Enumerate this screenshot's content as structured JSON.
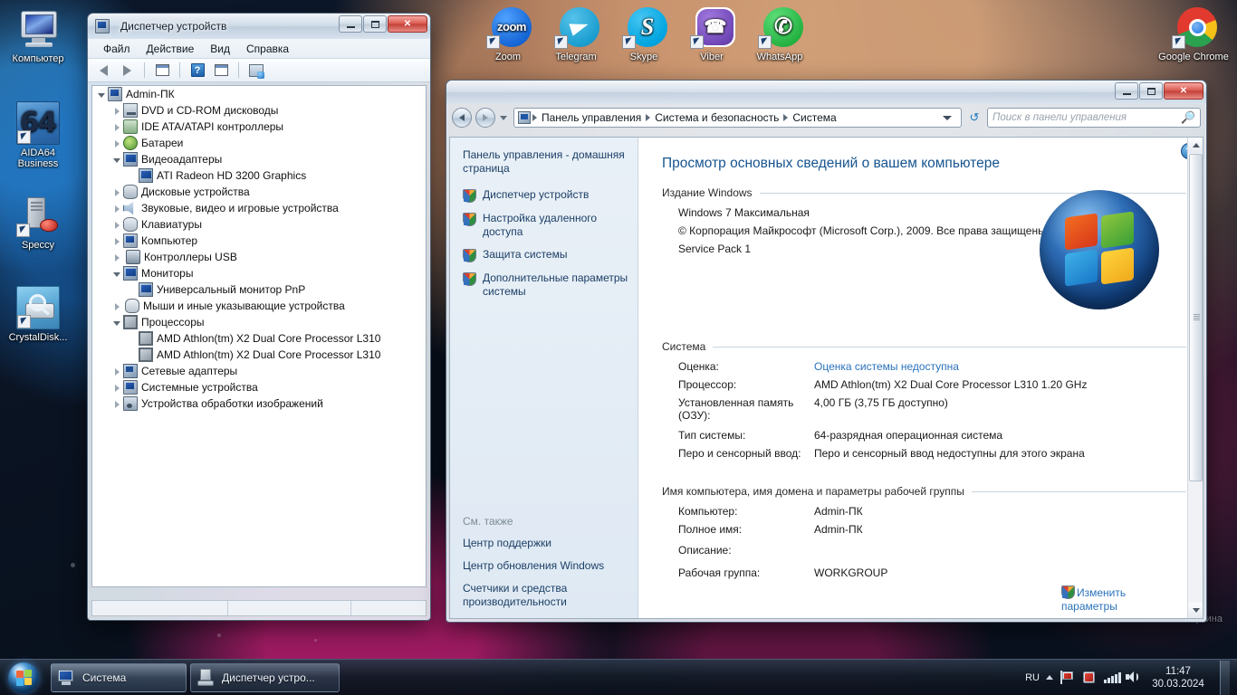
{
  "desktop": {
    "icons_left": [
      {
        "name": "Компьютер",
        "icon": "computer-icon"
      },
      {
        "name": "AIDA64 Business",
        "icon": "aida64-icon"
      },
      {
        "name": "Speccy",
        "icon": "speccy-icon"
      },
      {
        "name": "CrystalDisk...",
        "icon": "crystaldiskinfo-icon"
      }
    ],
    "icons_top": [
      {
        "name": "Zoom",
        "icon": "zoom-icon",
        "glyph": "zoom"
      },
      {
        "name": "Telegram",
        "icon": "telegram-icon",
        "glyph": ""
      },
      {
        "name": "Skype",
        "icon": "skype-icon",
        "glyph": "S"
      },
      {
        "name": "Viber",
        "icon": "viber-icon",
        "glyph": "☎"
      },
      {
        "name": "WhatsApp",
        "icon": "whatsapp-icon",
        "glyph": "✆"
      },
      {
        "name": "Google Chrome",
        "icon": "chrome-icon",
        "glyph": ""
      }
    ],
    "recycle_bin_label": "Корзина"
  },
  "device_manager": {
    "title": "Диспетчер устройств",
    "window_buttons": {
      "minimize": "–",
      "maximize": "□",
      "close": "✕"
    },
    "menu": [
      "Файл",
      "Действие",
      "Вид",
      "Справка"
    ],
    "toolbar": [
      {
        "name": "back-button",
        "glyph": "←"
      },
      {
        "name": "forward-button",
        "glyph": "→"
      },
      {
        "name": "properties-button",
        "glyph": "▤"
      },
      {
        "name": "help-button",
        "glyph": "?"
      },
      {
        "name": "show-hidden-button",
        "glyph": "▥"
      },
      {
        "name": "scan-hardware-button",
        "glyph": "⚙"
      }
    ],
    "tree": [
      {
        "label": "Admin-ПК",
        "level": 0,
        "state": "expanded",
        "icon": "computer-node-icon"
      },
      {
        "label": "DVD и CD-ROM дисководы",
        "level": 1,
        "state": "collapsed",
        "icon": "cdrom-icon"
      },
      {
        "label": "IDE ATA/ATAPI контроллеры",
        "level": 1,
        "state": "collapsed",
        "icon": "ide-controller-icon"
      },
      {
        "label": "Батареи",
        "level": 1,
        "state": "collapsed",
        "icon": "battery-icon"
      },
      {
        "label": "Видеоадаптеры",
        "level": 1,
        "state": "expanded",
        "icon": "display-adapter-icon"
      },
      {
        "label": "ATI Radeon HD 3200 Graphics",
        "level": 2,
        "state": "leaf",
        "icon": "display-adapter-icon"
      },
      {
        "label": "Дисковые устройства",
        "level": 1,
        "state": "collapsed",
        "icon": "disk-drive-icon"
      },
      {
        "label": "Звуковые, видео и игровые устройства",
        "level": 1,
        "state": "collapsed",
        "icon": "sound-device-icon"
      },
      {
        "label": "Клавиатуры",
        "level": 1,
        "state": "collapsed",
        "icon": "keyboard-icon"
      },
      {
        "label": "Компьютер",
        "level": 1,
        "state": "collapsed",
        "icon": "computer-node-icon"
      },
      {
        "label": "Контроллеры USB",
        "level": 1,
        "state": "collapsed",
        "icon": "usb-icon"
      },
      {
        "label": "Мониторы",
        "level": 1,
        "state": "expanded",
        "icon": "monitor-icon"
      },
      {
        "label": "Универсальный монитор PnP",
        "level": 2,
        "state": "leaf",
        "icon": "monitor-icon"
      },
      {
        "label": "Мыши и иные указывающие устройства",
        "level": 1,
        "state": "collapsed",
        "icon": "mouse-icon"
      },
      {
        "label": "Процессоры",
        "level": 1,
        "state": "expanded",
        "icon": "cpu-icon"
      },
      {
        "label": "AMD Athlon(tm) X2 Dual Core Processor L310",
        "level": 2,
        "state": "leaf",
        "icon": "cpu-icon"
      },
      {
        "label": "AMD Athlon(tm) X2 Dual Core Processor L310",
        "level": 2,
        "state": "leaf",
        "icon": "cpu-icon"
      },
      {
        "label": "Сетевые адаптеры",
        "level": 1,
        "state": "collapsed",
        "icon": "network-adapter-icon"
      },
      {
        "label": "Системные устройства",
        "level": 1,
        "state": "collapsed",
        "icon": "system-device-icon"
      },
      {
        "label": "Устройства обработки изображений",
        "level": 1,
        "state": "collapsed",
        "icon": "imaging-device-icon"
      }
    ]
  },
  "system_window": {
    "window_buttons": {
      "minimize": "–",
      "maximize": "□",
      "close": "✕"
    },
    "breadcrumb": [
      "Панель управления",
      "Система и безопасность",
      "Система"
    ],
    "search_placeholder": "Поиск в панели управления",
    "sidebar": {
      "home": "Панель управления - домашняя страница",
      "links": [
        "Диспетчер устройств",
        "Настройка удаленного доступа",
        "Защита системы",
        "Дополнительные параметры системы"
      ],
      "see_also_title": "См. также",
      "see_also": [
        "Центр поддержки",
        "Центр обновления Windows",
        "Счетчики и средства производительности"
      ]
    },
    "main": {
      "heading": "Просмотр основных сведений о вашем компьютере",
      "sections": [
        {
          "title": "Издание Windows",
          "lines": [
            "Windows 7 Максимальная",
            "© Корпорация Майкрософт (Microsoft Corp.), 2009. Все права защищены.",
            "Service Pack 1"
          ]
        },
        {
          "title": "Система",
          "rows": [
            {
              "key": "Оценка:",
              "value": "Оценка системы недоступна",
              "link": true
            },
            {
              "key": "Процессор:",
              "value": "AMD Athlon(tm) X2 Dual Core Processor L310   1.20 GHz",
              "link": false
            },
            {
              "key": "Установленная память (ОЗУ):",
              "value": "4,00 ГБ (3,75 ГБ доступно)",
              "link": false
            },
            {
              "key": "Тип системы:",
              "value": "64-разрядная операционная система",
              "link": false
            },
            {
              "key": "Перо и сенсорный ввод:",
              "value": "Перо и сенсорный ввод недоступны для этого экрана",
              "link": false
            }
          ]
        },
        {
          "title": "Имя компьютера, имя домена и параметры рабочей группы",
          "rows": [
            {
              "key": "Компьютер:",
              "value": "Admin-ПК",
              "link": false
            },
            {
              "key": "Полное имя:",
              "value": "Admin-ПК",
              "link": false
            },
            {
              "key": "Описание:",
              "value": "",
              "link": false
            },
            {
              "key": "Рабочая группа:",
              "value": "WORKGROUP",
              "link": false
            }
          ]
        }
      ],
      "change_settings": "Изменить параметры",
      "help_glyph": "?"
    }
  },
  "taskbar": {
    "start_label": "Пуск",
    "buttons": [
      {
        "label": "Система",
        "icon": "system-window-icon",
        "active": true
      },
      {
        "label": "Диспетчер устро...",
        "icon": "device-manager-icon",
        "active": false
      }
    ],
    "tray": {
      "language": "RU",
      "icons": [
        "show-hidden-icons",
        "security-flag-icon",
        "update-icon",
        "network-icon",
        "volume-icon"
      ],
      "time": "11:47",
      "date": "30.03.2024"
    }
  },
  "colors": {
    "accent_link": "#2a72bb",
    "heading": "#16548f",
    "window_close": "#d9564c",
    "taskbar": "#121a26"
  }
}
